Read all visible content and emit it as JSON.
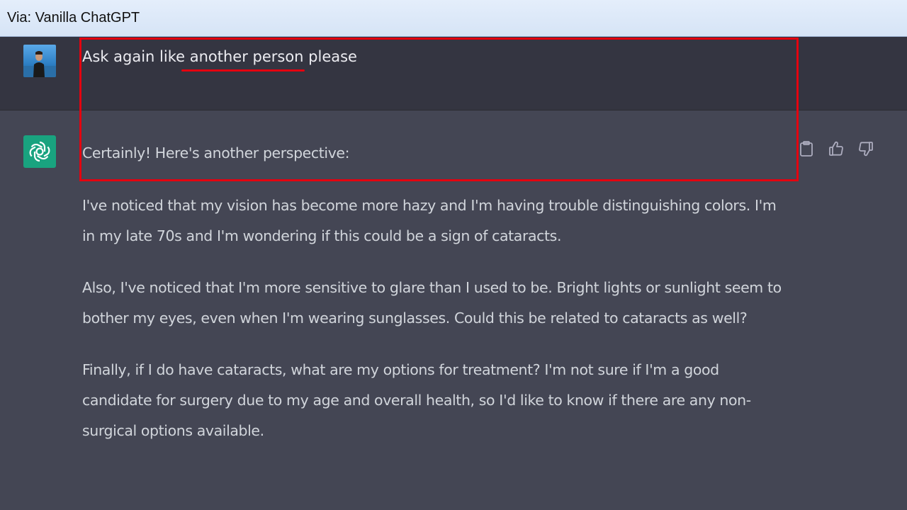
{
  "window": {
    "title": "Via: Vanilla ChatGPT"
  },
  "conversation": {
    "user_message": {
      "text": "Ask again like another person please",
      "avatar": "user-photo"
    },
    "assistant_message": {
      "avatar": "openai-logo-icon",
      "intro": "Certainly! Here's another perspective:",
      "paragraphs": [
        "I've noticed that my vision has become more hazy and I'm having trouble distinguishing colors. I'm in my late 70s and I'm wondering if this could be a sign of cataracts.",
        "Also, I've noticed that I'm more sensitive to glare than I used to be. Bright lights or sunlight seem to bother my eyes, even when I'm wearing sunglasses. Could this be related to cataracts as well?",
        "Finally, if I do have cataracts, what are my options for treatment? I'm not sure if I'm a good candidate for surgery due to my age and overall health, so I'd like to know if there are any non-surgical options available."
      ],
      "actions": [
        "clipboard-icon",
        "thumbs-up-icon",
        "thumbs-down-icon"
      ]
    }
  },
  "annotations": {
    "highlight_color": "#e4000f",
    "underlined_phrase": "another person"
  },
  "colors": {
    "user_row_bg": "#343541",
    "assistant_row_bg": "#444654",
    "bot_avatar_bg": "#19a37f"
  }
}
